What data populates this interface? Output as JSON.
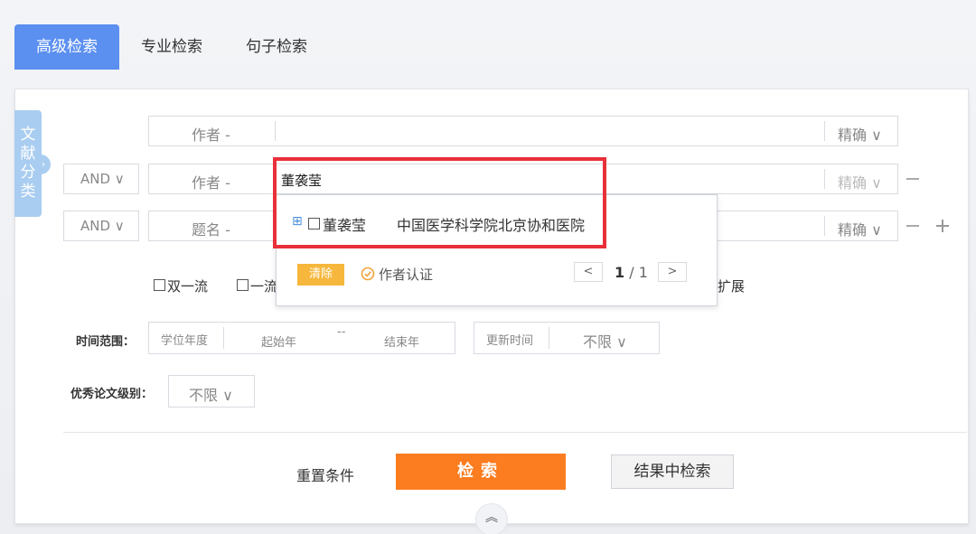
{
  "tabs": [
    {
      "label": "高级检索",
      "active": true
    },
    {
      "label": "专业检索",
      "active": false
    },
    {
      "label": "句子检索",
      "active": false
    }
  ],
  "category_tab": {
    "label_chars": [
      "文",
      "献",
      "分",
      "类"
    ],
    "arrow": "›"
  },
  "rows": [
    {
      "logic": "",
      "field": "作者 -",
      "value": "",
      "match": "精确 ∨"
    },
    {
      "logic": "AND ∨",
      "field": "作者 -",
      "value": "董袭莹",
      "match": "精确 ∨"
    },
    {
      "logic": "AND ∨",
      "field": "题名 -",
      "value": "",
      "match": "精确 ∨"
    }
  ],
  "row_controls": {
    "minus": "−",
    "plus": "+"
  },
  "suggestion": {
    "expand_icon": "⊞",
    "name": "董袭莹",
    "institution": "中国医学科学院北京协和医院",
    "clear_label": "清除",
    "verify_icon": "check-circle-icon",
    "verify_label": "作者认证",
    "prev": "<",
    "next": ">",
    "page_current": "1",
    "page_sep": " / ",
    "page_total": "1",
    "highlight_color": "#e8303a"
  },
  "filters": {
    "checkbox1": "双一流",
    "checkbox2": "一流",
    "extend_label": "扩展"
  },
  "time_range": {
    "label": "时间范围：",
    "degree_year": "学位年度",
    "start_year": "起始年",
    "separator": "--",
    "end_year": "结束年",
    "update_label": "更新时间",
    "update_value": "不限 ∨"
  },
  "excellent": {
    "label": "优秀论文级别：",
    "value": "不限 ∨"
  },
  "actions": {
    "reset": "重置条件",
    "search": "检索",
    "search_within": "结果中检索",
    "collapse_icon": "︽"
  },
  "colors": {
    "tab_active": "#5b8ff0",
    "search_button": "#fb7d1f",
    "clear_button": "#f6b73c"
  }
}
